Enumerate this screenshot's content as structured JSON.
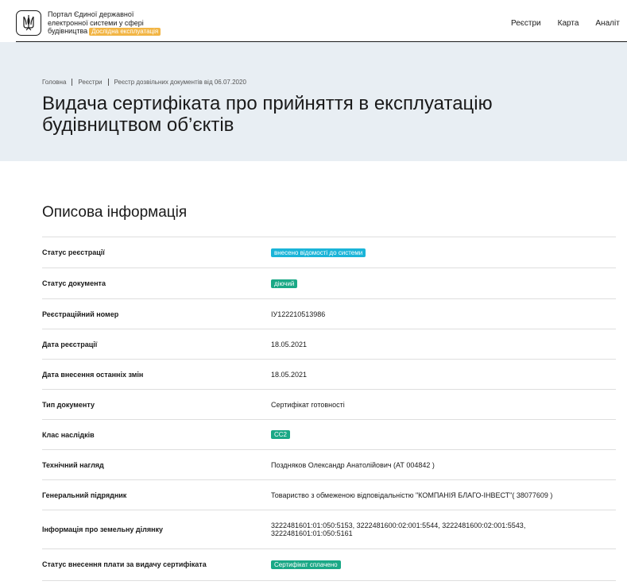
{
  "header": {
    "logo_icon": "trident-icon",
    "portal_line1": "Портал Єдиної державної",
    "portal_line2": "електронної системи у сфері",
    "portal_line3": "будівництва",
    "beta_label": "Дослідна експлуатація",
    "nav": [
      "Реєстри",
      "Карта",
      "Аналіт"
    ]
  },
  "breadcrumb": [
    "Головна",
    "Реєстри",
    "Реєстр дозвільних документів від 06.07.2020"
  ],
  "page_title": "Видача сертифіката про прийняття в експлуатацію\nбудівництвом об’єктів",
  "section_title": "Описова інформація",
  "colors": {
    "badge_blue": "#1ab4d8",
    "badge_green": "#1aa886",
    "beta": "#f2b544",
    "hero_bg": "#e8eef3"
  },
  "rows": [
    {
      "label": "Статус реєстрації",
      "value": "внесено відомості до системи",
      "type": "badge",
      "color": "#1ab4d8"
    },
    {
      "label": "Статус документа",
      "value": "діючий",
      "type": "badge",
      "color": "#1aa886"
    },
    {
      "label": "Реєстраційний номер",
      "value": "ІУ122210513986",
      "type": "text"
    },
    {
      "label": "Дата реєстрації",
      "value": "18.05.2021",
      "type": "text"
    },
    {
      "label": "Дата внесення останніх змін",
      "value": "18.05.2021",
      "type": "text"
    },
    {
      "label": "Тип документу",
      "value": "Сертифікат готовності",
      "type": "text"
    },
    {
      "label": "Клас наслідків",
      "value": "СС2",
      "type": "badge",
      "color": "#1aa886"
    },
    {
      "label": "Технічний нагляд",
      "value": "Поздняков Олександр Анатолійович (АТ 004842 )",
      "type": "text"
    },
    {
      "label": "Генеральний підрядник",
      "value": "Товариство з обмеженою відповідальністю \"КОМПАНІЯ БЛАГО-ІНВЕСТ\"( 38077609 )",
      "type": "text"
    },
    {
      "label": "Інформація про земельну ділянку",
      "value": "3222481601:01:050:5153, 3222481600:02:001:5544, 3222481600:02:001:5543,",
      "value2": "3222481601:01:050:5161",
      "type": "text2"
    },
    {
      "label": "Статус внесення плати за видачу сертифіката",
      "value": "Сертифікат сплачено",
      "type": "badge",
      "color": "#1aa886"
    }
  ]
}
